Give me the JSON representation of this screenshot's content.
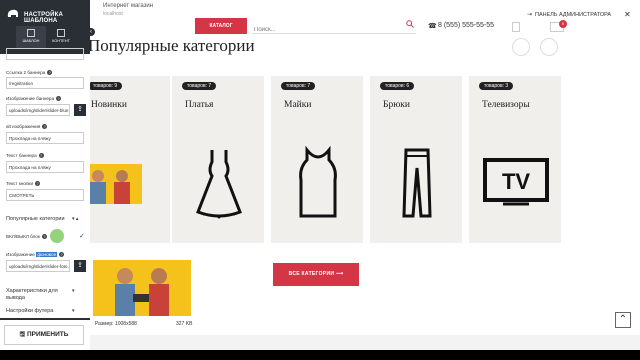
{
  "panel": {
    "title": "НАСТРОЙКА ШАБЛОНА",
    "tabs": [
      {
        "label": "ШАБЛОН",
        "icon": "template-icon",
        "active": true
      },
      {
        "label": "КОНТЕНТ",
        "icon": "content-icon",
        "active": false
      }
    ],
    "fields": [
      {
        "label": "",
        "value": "",
        "key": "top-input"
      },
      {
        "label": "Ссылка 2 баннера",
        "value": "/registration"
      },
      {
        "label": "Изображение баннера",
        "value": "uploads/img/slider/slider-blue.jpg"
      },
      {
        "label": "alt изображения",
        "value": "Прохлада на пляжу"
      },
      {
        "label": "Текст баннера",
        "value": "Прохлада на пляжу"
      },
      {
        "label": "Текст кнопки",
        "value": "СМОТРЕТЬ"
      }
    ],
    "group_popular": "Популярные категории",
    "toggle_label": "ВКЛ/ВЫКЛ блок",
    "image_label_prefix": "Изображение",
    "image_label_hl": "фоновое",
    "image_value": "uploads/img/slider/slider-foto.jpg",
    "group_output": "Характеристики для вывода",
    "group_footer": "Настройки футера",
    "apply_label": "ПРИМЕНИТЬ"
  },
  "header": {
    "store_name": "Интернет магазин",
    "store_sub": "localhost",
    "catalog": "КАТАЛОГ",
    "search_placeholder": "Поиск...",
    "phone": "8 (555) 555-55-55",
    "admin_link": "ПАНЕЛЬ АДМИНИСТРАТОРА",
    "cart_count": "0"
  },
  "main": {
    "section_title": "Популярные категории",
    "categories": [
      {
        "badge": "товаров: 9",
        "title": "Новинки"
      },
      {
        "badge": "товаров: 7",
        "title": "Платья"
      },
      {
        "badge": "товаров: 7",
        "title": "Майки"
      },
      {
        "badge": "товаров: 6",
        "title": "Брюки"
      },
      {
        "badge": "товаров: 3",
        "title": "Телевизоры"
      }
    ],
    "all_categories": "ВСЕ КАТЕГОРИИ",
    "preview_size": "Размер: 1008x588",
    "preview_weight": "327 KB"
  }
}
